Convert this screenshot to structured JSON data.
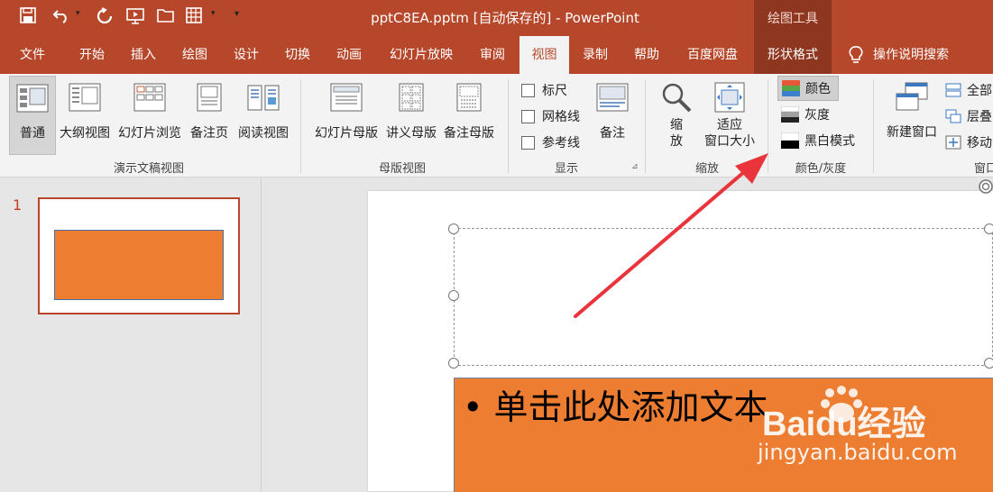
{
  "titlebar": {
    "title": "pptC8EA.pptm [自动保存的]  -  PowerPoint",
    "context_tool": "绘图工具"
  },
  "quick_access": [
    "save-icon",
    "undo-icon",
    "repeat-icon",
    "slideshow-icon",
    "open-icon",
    "table-icon",
    "customize-icon"
  ],
  "tabs": [
    {
      "label": "文件"
    },
    {
      "label": "开始"
    },
    {
      "label": "插入"
    },
    {
      "label": "绘图"
    },
    {
      "label": "设计"
    },
    {
      "label": "切换"
    },
    {
      "label": "动画"
    },
    {
      "label": "幻灯片放映"
    },
    {
      "label": "审阅"
    },
    {
      "label": "视图"
    },
    {
      "label": "录制"
    },
    {
      "label": "帮助"
    },
    {
      "label": "百度网盘"
    },
    {
      "label": "形状格式"
    },
    {
      "label": "操作说明搜索"
    }
  ],
  "ribbon": {
    "presentation_views": {
      "label": "演示文稿视图",
      "buttons": [
        "普通",
        "大纲视图",
        "幻灯片浏览",
        "备注页",
        "阅读视图"
      ]
    },
    "master_views": {
      "label": "母版视图",
      "buttons": [
        "幻灯片母版",
        "讲义母版",
        "备注母版"
      ]
    },
    "show": {
      "label": "显示",
      "checkboxes": [
        "标尺",
        "网格线",
        "参考线"
      ],
      "notes": "备注"
    },
    "zoom": {
      "label": "缩放",
      "zoom_top": "缩",
      "zoom_bottom": "放",
      "fit_top": "适应",
      "fit_bottom": "窗口大小"
    },
    "color_grayscale": {
      "label": "颜色/灰度",
      "options": [
        "颜色",
        "灰度",
        "黑白模式"
      ]
    },
    "window": {
      "label": "窗口",
      "new_window": "新建窗口",
      "items": [
        "全部",
        "层叠",
        "移动"
      ]
    }
  },
  "thumbnails": {
    "slide_number": "1"
  },
  "slide": {
    "bullet": "•",
    "content_text": "单击此处添加文本"
  },
  "watermark": {
    "brand": "Baidu经验",
    "url": "jingyan.baidu.com"
  },
  "colors": {
    "accent": "#b7472a",
    "context_tab": "#8f3620",
    "shape_fill": "#ed7d31",
    "arrow": "#e8343a"
  }
}
